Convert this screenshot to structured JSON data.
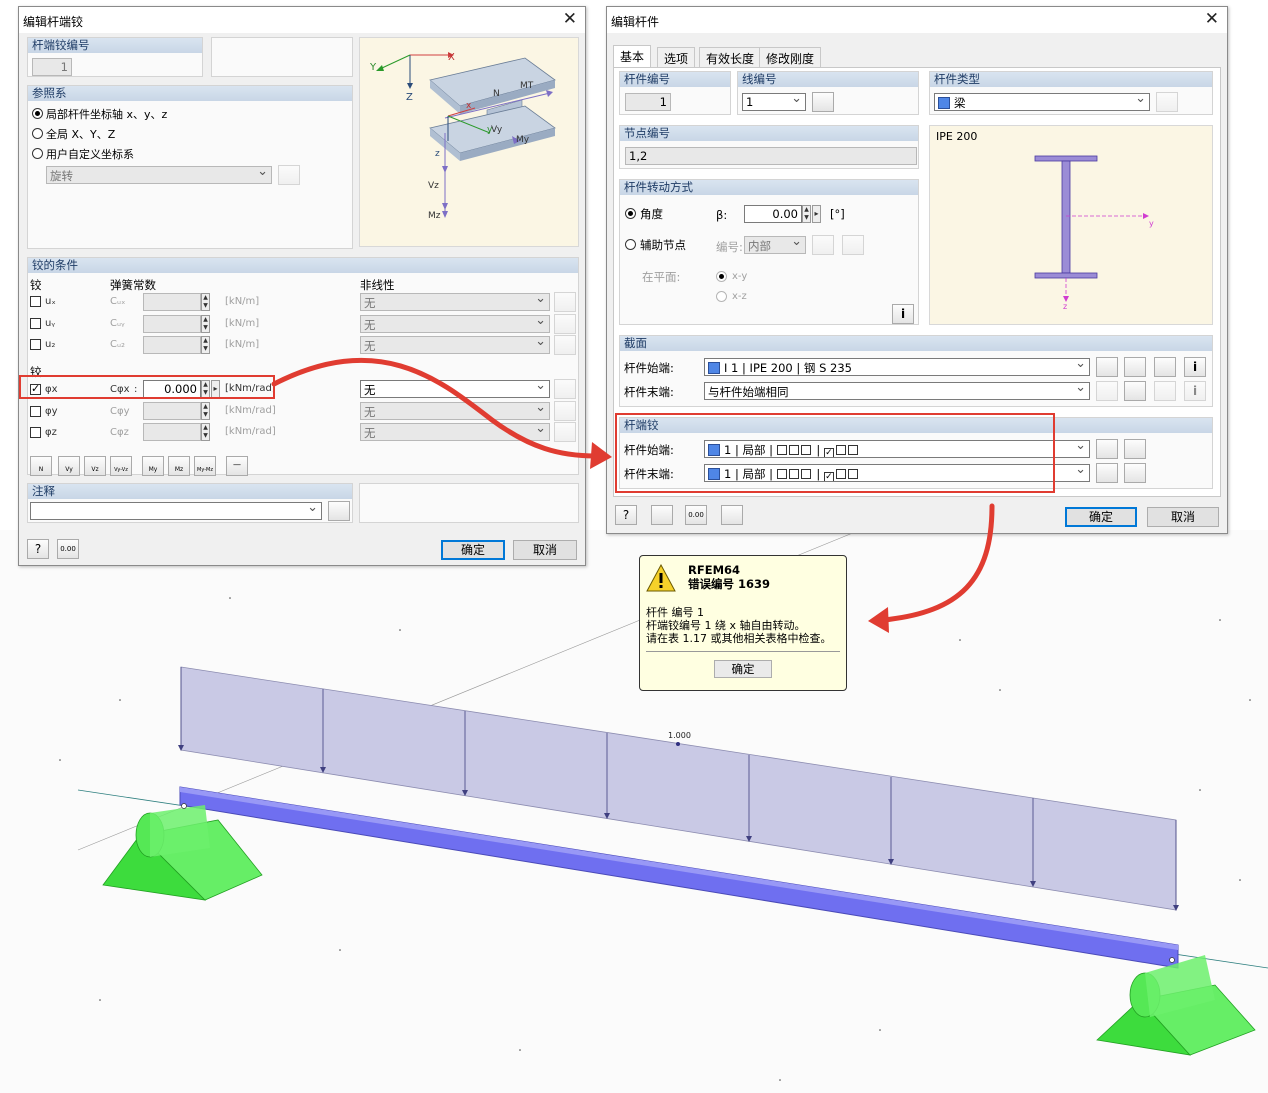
{
  "hinge_dialog": {
    "title": "编辑杆端铰",
    "no_group_title": "杆端铰编号",
    "no_value": "1",
    "ref_group_title": "参照系",
    "ref_options": [
      {
        "label": "局部杆件坐标轴 x、y、z",
        "selected": true
      },
      {
        "label": "全局 X、Y、Z",
        "selected": false
      },
      {
        "label": "用户自定义坐标系",
        "selected": false
      }
    ],
    "rotation_select": "旋转",
    "conditions_title": "铰的条件",
    "col_hinge": "铰",
    "col_spring": "弹簧常数",
    "col_nonlinear": "非线性",
    "translation_rows": [
      {
        "dof": "uₓ",
        "const": "Cᵤₓ",
        "value": "",
        "unit": "[kN/m]",
        "nonlinear": "无",
        "checked": false
      },
      {
        "dof": "uᵧ",
        "const": "Cᵤᵧ",
        "value": "",
        "unit": "[kN/m]",
        "nonlinear": "无",
        "checked": false
      },
      {
        "dof": "u₂",
        "const": "Cᵤ₂",
        "value": "",
        "unit": "[kN/m]",
        "nonlinear": "无",
        "checked": false
      }
    ],
    "rotation_label": "铰",
    "rotation_rows": [
      {
        "dof": "φx",
        "const": "Cφx",
        "value": "0.000",
        "unit": "[kNm/rad]",
        "nonlinear": "无",
        "checked": true
      },
      {
        "dof": "φy",
        "const": "Cφy",
        "value": "",
        "unit": "[kNm/rad]",
        "nonlinear": "无",
        "checked": false
      },
      {
        "dof": "φz",
        "const": "Cφz",
        "value": "",
        "unit": "[kNm/rad]",
        "nonlinear": "无",
        "checked": false
      }
    ],
    "shortcut_labels": [
      "N",
      "Vy",
      "Vz",
      "Vy-Vz",
      "My",
      "Mz",
      "My-Mz",
      "—"
    ],
    "comment_title": "注释",
    "comment_value": "",
    "ok": "确定",
    "cancel": "取消",
    "diagram_labels": {
      "X": "X",
      "Y": "Y",
      "Z": "Z",
      "x": "x",
      "y": "y",
      "z": "z",
      "N": "N",
      "MT": "MT",
      "My": "My",
      "Vy": "Vy",
      "Vz": "Vz",
      "Mz": "Mz"
    }
  },
  "member_dialog": {
    "title": "编辑杆件",
    "tabs": [
      "基本",
      "选项",
      "有效长度",
      "修改刚度"
    ],
    "member_no_title": "杆件编号",
    "member_no": "1",
    "line_no_title": "线编号",
    "line_no": "1",
    "member_type_title": "杆件类型",
    "member_type": "梁",
    "node_no_title": "节点编号",
    "node_no": "1,2",
    "rotation_title": "杆件转动方式",
    "angle_label": "角度",
    "beta_label": "β:",
    "beta_value": "0.00",
    "beta_unit": "[°]",
    "aux_node_label": "辅助节点",
    "no_label": "编号:",
    "aux_select": "内部",
    "in_plane_label": "在平面:",
    "plane_xy": "x-y",
    "plane_xz": "x-z",
    "section_preview": "IPE 200",
    "section_title": "截面",
    "start_label": "杆件始端:",
    "end_label": "杆件末端:",
    "section_start": "I  1 | IPE 200 | 钢 S 235",
    "section_end": "与杆件始端相同",
    "hinge_title": "杆端铰",
    "hinge_start_no": "1",
    "hinge_start_sys": "局部",
    "hinge_end_no": "1",
    "hinge_end_sys": "局部",
    "ok": "确定",
    "cancel": "取消",
    "colors": {
      "accent": "#0078d7",
      "swatch": "#4f86e6"
    }
  },
  "error_popup": {
    "app": "RFEM64",
    "code_line": "错误编号 1639",
    "lines": [
      "杆件 编号 1",
      "杆端铰编号 1 绕 x 轴自由转动。",
      "请在表 1.17 或其他相关表格中检查。"
    ],
    "ok": "确定"
  },
  "model_view": {
    "load_label": "1.000",
    "colors": {
      "beam": "#6f6ff0",
      "support": "#33dd33",
      "load": "#c8c8e6"
    }
  }
}
